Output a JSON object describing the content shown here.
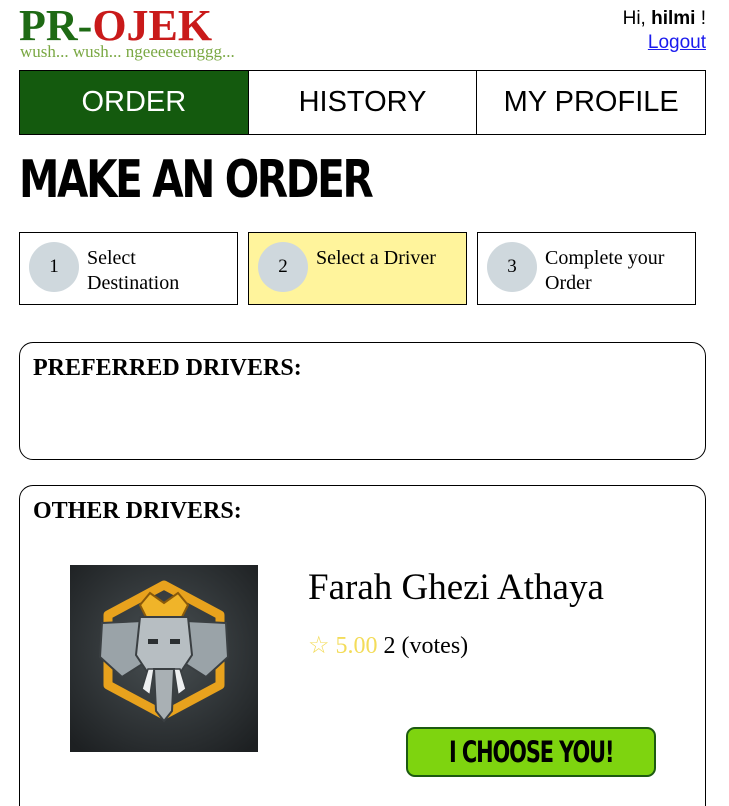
{
  "header": {
    "logo_part1": "PR-",
    "logo_part2": "OJEK",
    "tagline": "wush... wush... ngeeeeeenggg...",
    "greeting_prefix": "Hi, ",
    "username": "hilmi",
    "greeting_suffix": " !",
    "logout_label": "Logout"
  },
  "tabs": [
    {
      "label": "ORDER",
      "active": true
    },
    {
      "label": "HISTORY",
      "active": false
    },
    {
      "label": "MY PROFILE",
      "active": false
    }
  ],
  "page_title": "MAKE AN ORDER",
  "steps": [
    {
      "number": "1",
      "label": "Select Destination"
    },
    {
      "number": "2",
      "label": "Select a Driver"
    },
    {
      "number": "3",
      "label": "Complete your Order"
    }
  ],
  "preferred": {
    "title": "PREFERRED DRIVERS:"
  },
  "others": {
    "title": "OTHER DRIVERS:",
    "driver": {
      "name": "Farah Ghezi Athaya",
      "star": "☆",
      "rating": "5.00",
      "votes": "2 (votes)",
      "button_label": "I CHOOSE YOU!"
    }
  },
  "colors": {
    "brand_green": "#1e6a14",
    "brand_red": "#c91a1a",
    "tab_active": "#145a0e",
    "step_active": "#fff49c",
    "button_green": "#7ed40f",
    "star_yellow": "#f3dc5a"
  }
}
